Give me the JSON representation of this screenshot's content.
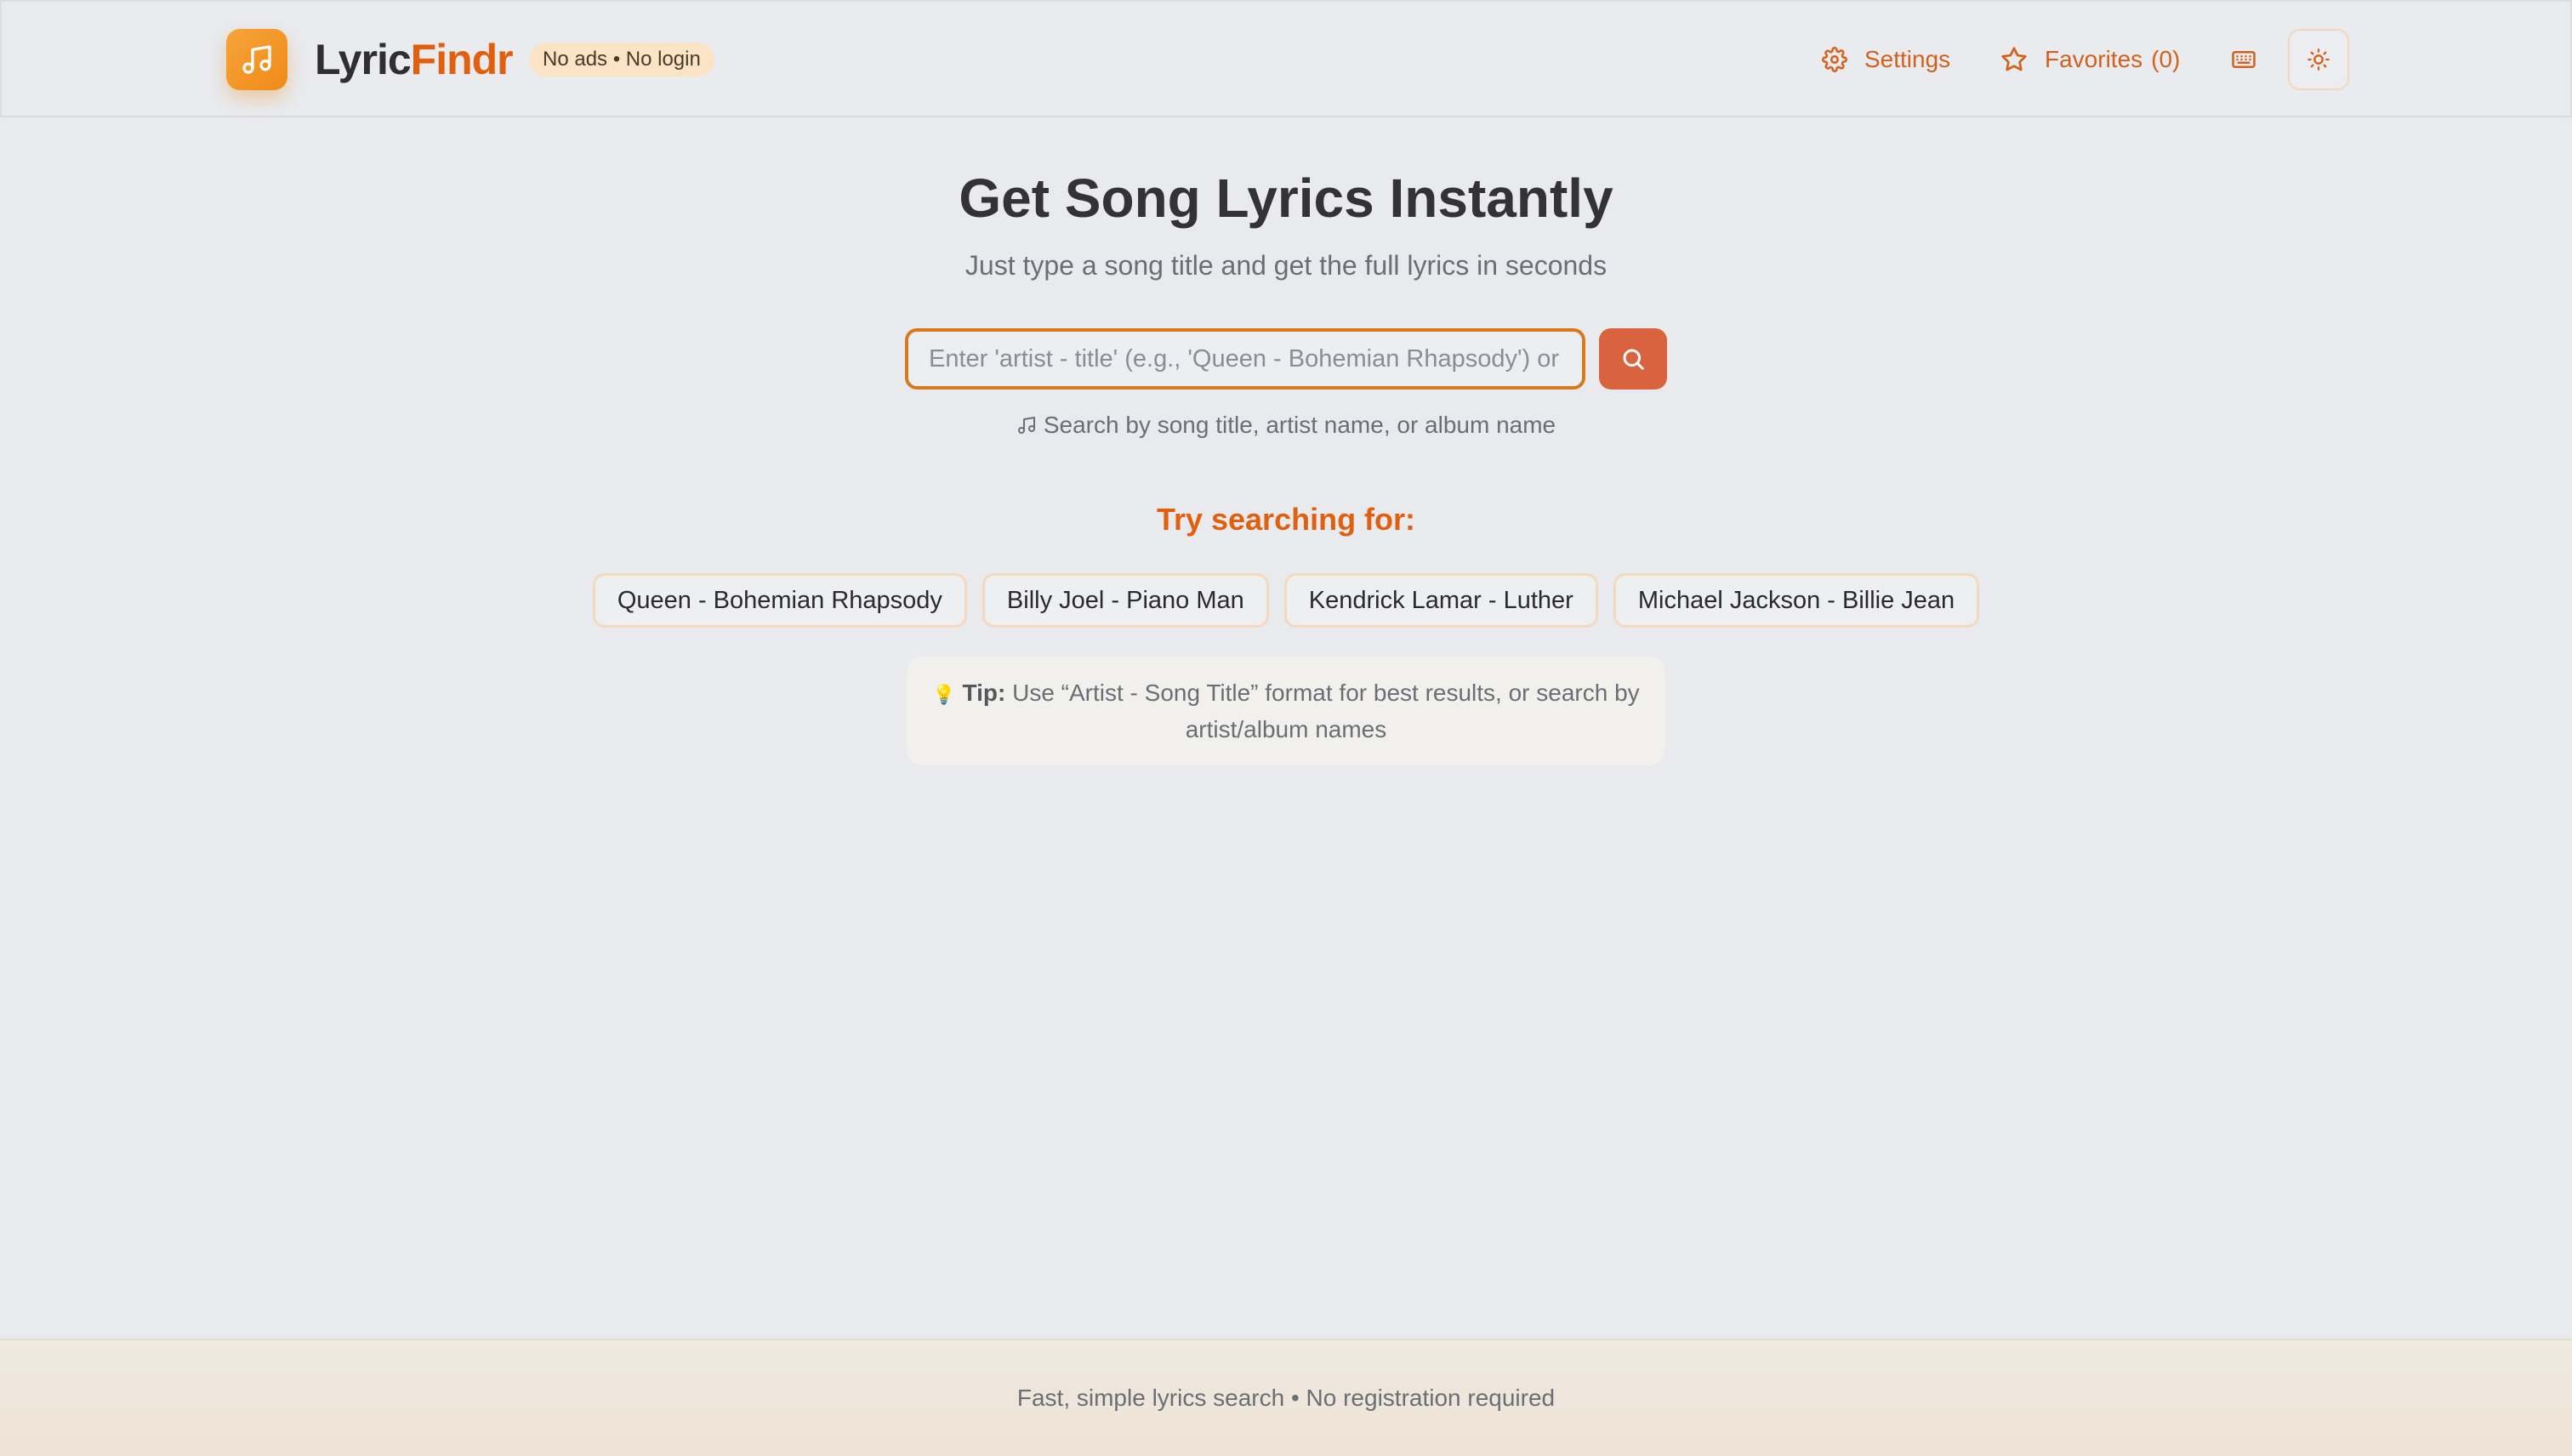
{
  "header": {
    "brand_part1": "Lyric",
    "brand_part2": "Findr",
    "badge": "No ads • No login",
    "settings_label": "Settings",
    "favorites_label": "Favorites",
    "favorites_count": "(0)",
    "icons": {
      "logo": "music-note-icon",
      "settings": "gear-icon",
      "favorites": "star-icon",
      "keyboard": "keyboard-icon",
      "theme": "sun-icon"
    }
  },
  "hero": {
    "title": "Get Song Lyrics Instantly",
    "subtitle": "Just type a song title and get the full lyrics in seconds"
  },
  "search": {
    "placeholder": "Enter 'artist - title' (e.g., 'Queen - Bohemian Rhapsody') or search",
    "value": "",
    "hint": "Search by song title, artist name, or album name"
  },
  "suggestions": {
    "title": "Try searching for:",
    "items": [
      "Queen - Bohemian Rhapsody",
      "Billy Joel - Piano Man",
      "Kendrick Lamar - Luther",
      "Michael Jackson - Billie Jean"
    ]
  },
  "tip": {
    "label": "Tip:",
    "text": "Use “Artist - Song Title” format for best results, or search by artist/album names"
  },
  "footer": {
    "text": "Fast, simple lyrics search • No registration required"
  },
  "colors": {
    "accent": "#e0600f",
    "search_button": "#d9623f",
    "background": "#e8eaee"
  }
}
